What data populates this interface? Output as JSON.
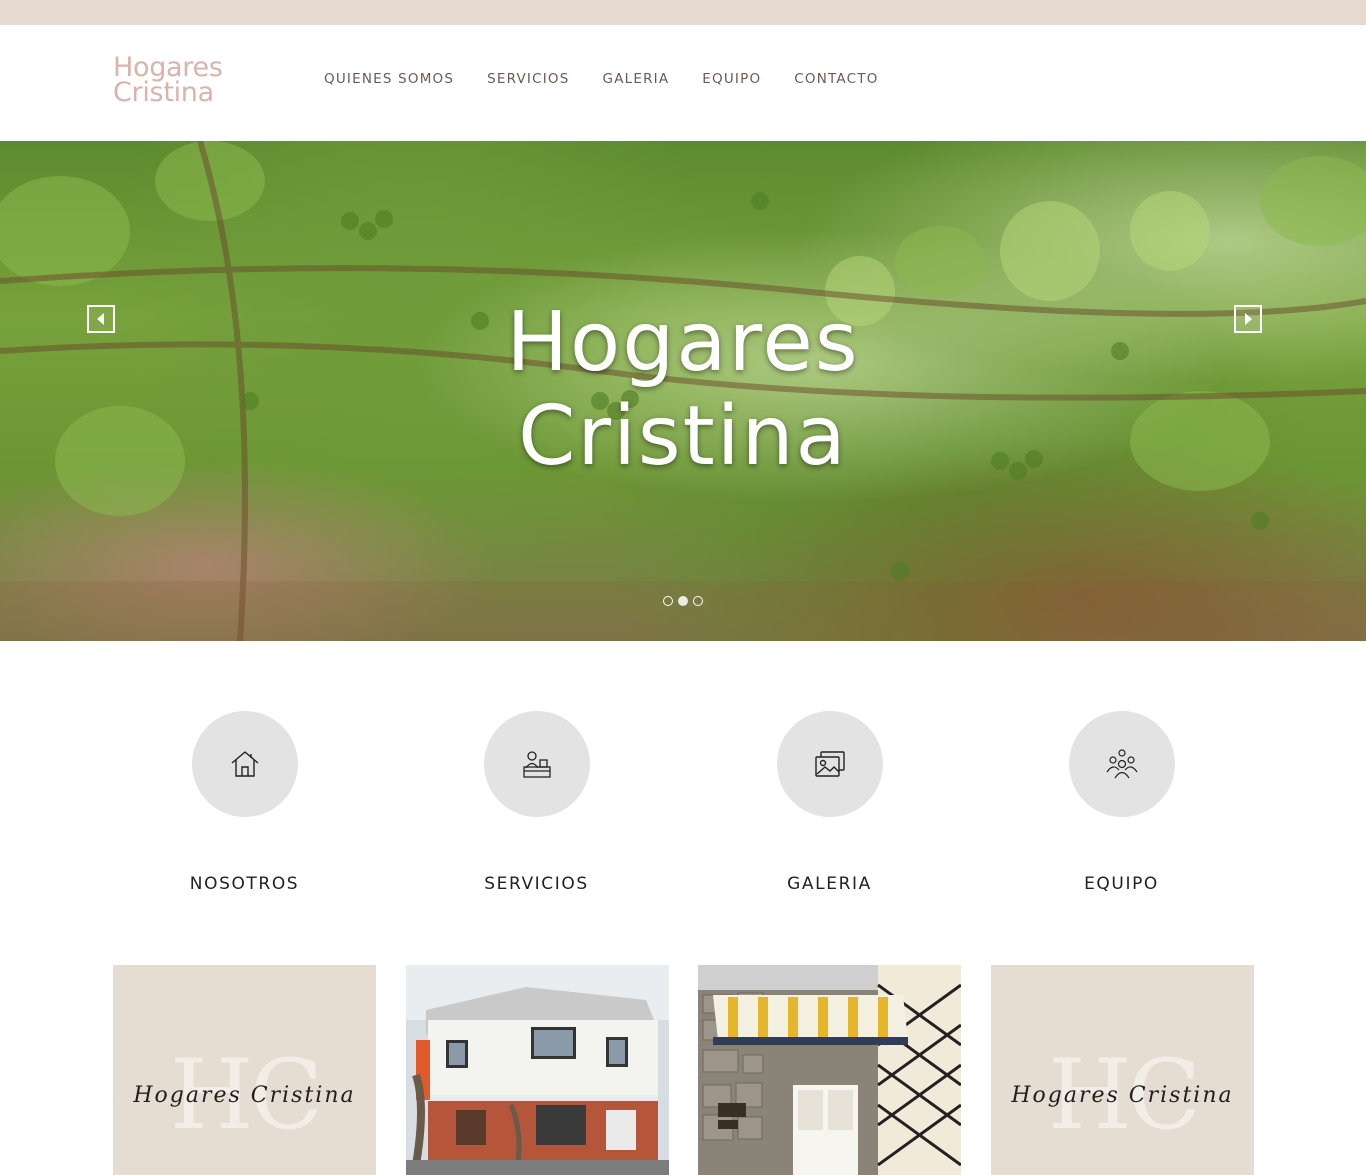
{
  "header": {
    "logo_line1": "Hogares",
    "logo_line2": "Cristina",
    "nav": [
      "QUIENES SOMOS",
      "SERVICIOS",
      "GALERIA",
      "EQUIPO",
      "CONTACTO"
    ]
  },
  "hero": {
    "title_line1": "Hogares",
    "title_line2": "Cristina",
    "prev_icon": "chevron-left-icon",
    "next_icon": "chevron-right-icon",
    "slides": 3,
    "active_slide": 2
  },
  "features": [
    {
      "label": "NOSOTROS",
      "icon": "house-icon"
    },
    {
      "label": "SERVICIOS",
      "icon": "reception-desk-icon"
    },
    {
      "label": "GALERIA",
      "icon": "photo-gallery-icon"
    },
    {
      "label": "EQUIPO",
      "icon": "team-icon"
    }
  ],
  "cards": {
    "card1": {
      "monogram": "HC",
      "script": "Hogares Cristina"
    },
    "card4": {
      "monogram": "HC",
      "script": "Hogares Cristina"
    }
  },
  "colors": {
    "topbar": "#e6d9cf",
    "logo": "#d8b4aa",
    "nav_text": "#6b5a52",
    "circle_bg": "#e3e3e3",
    "brand_card_bg": "#e6ddd2"
  }
}
